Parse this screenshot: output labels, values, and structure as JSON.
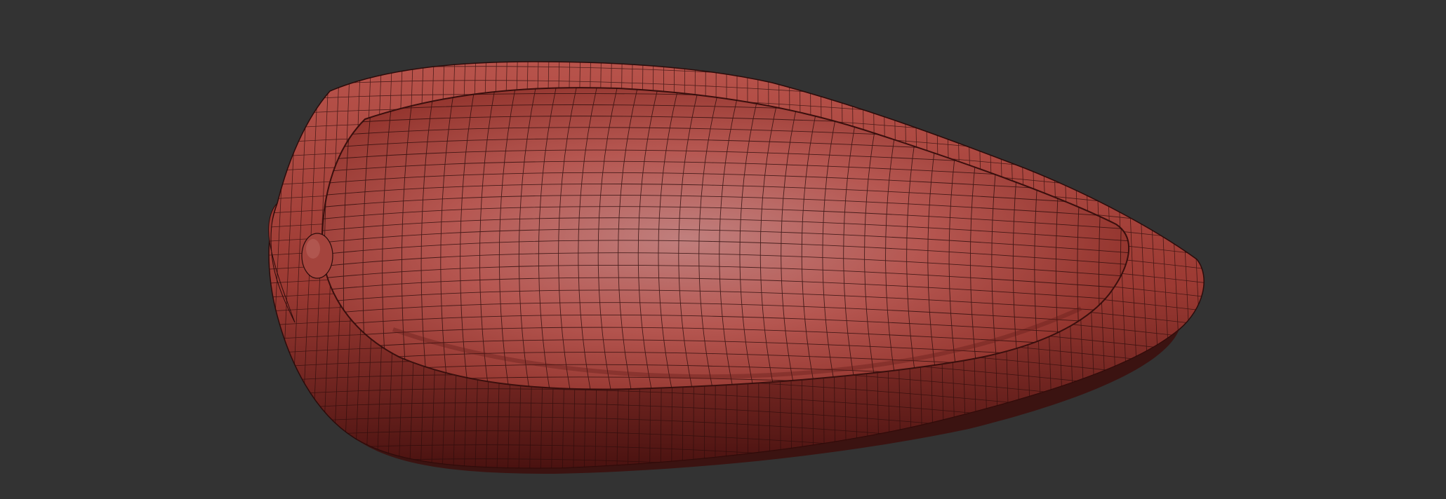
{
  "viewport": {
    "background_color": "#333333",
    "model": {
      "name": "sculpted-mesh",
      "display": "polyframe",
      "wireframe_visible": true,
      "material_color": "#a8433c",
      "highlight_color": "#c97a78",
      "shadow_color": "#4a1412",
      "wire_color": "#2b0c0b"
    }
  }
}
